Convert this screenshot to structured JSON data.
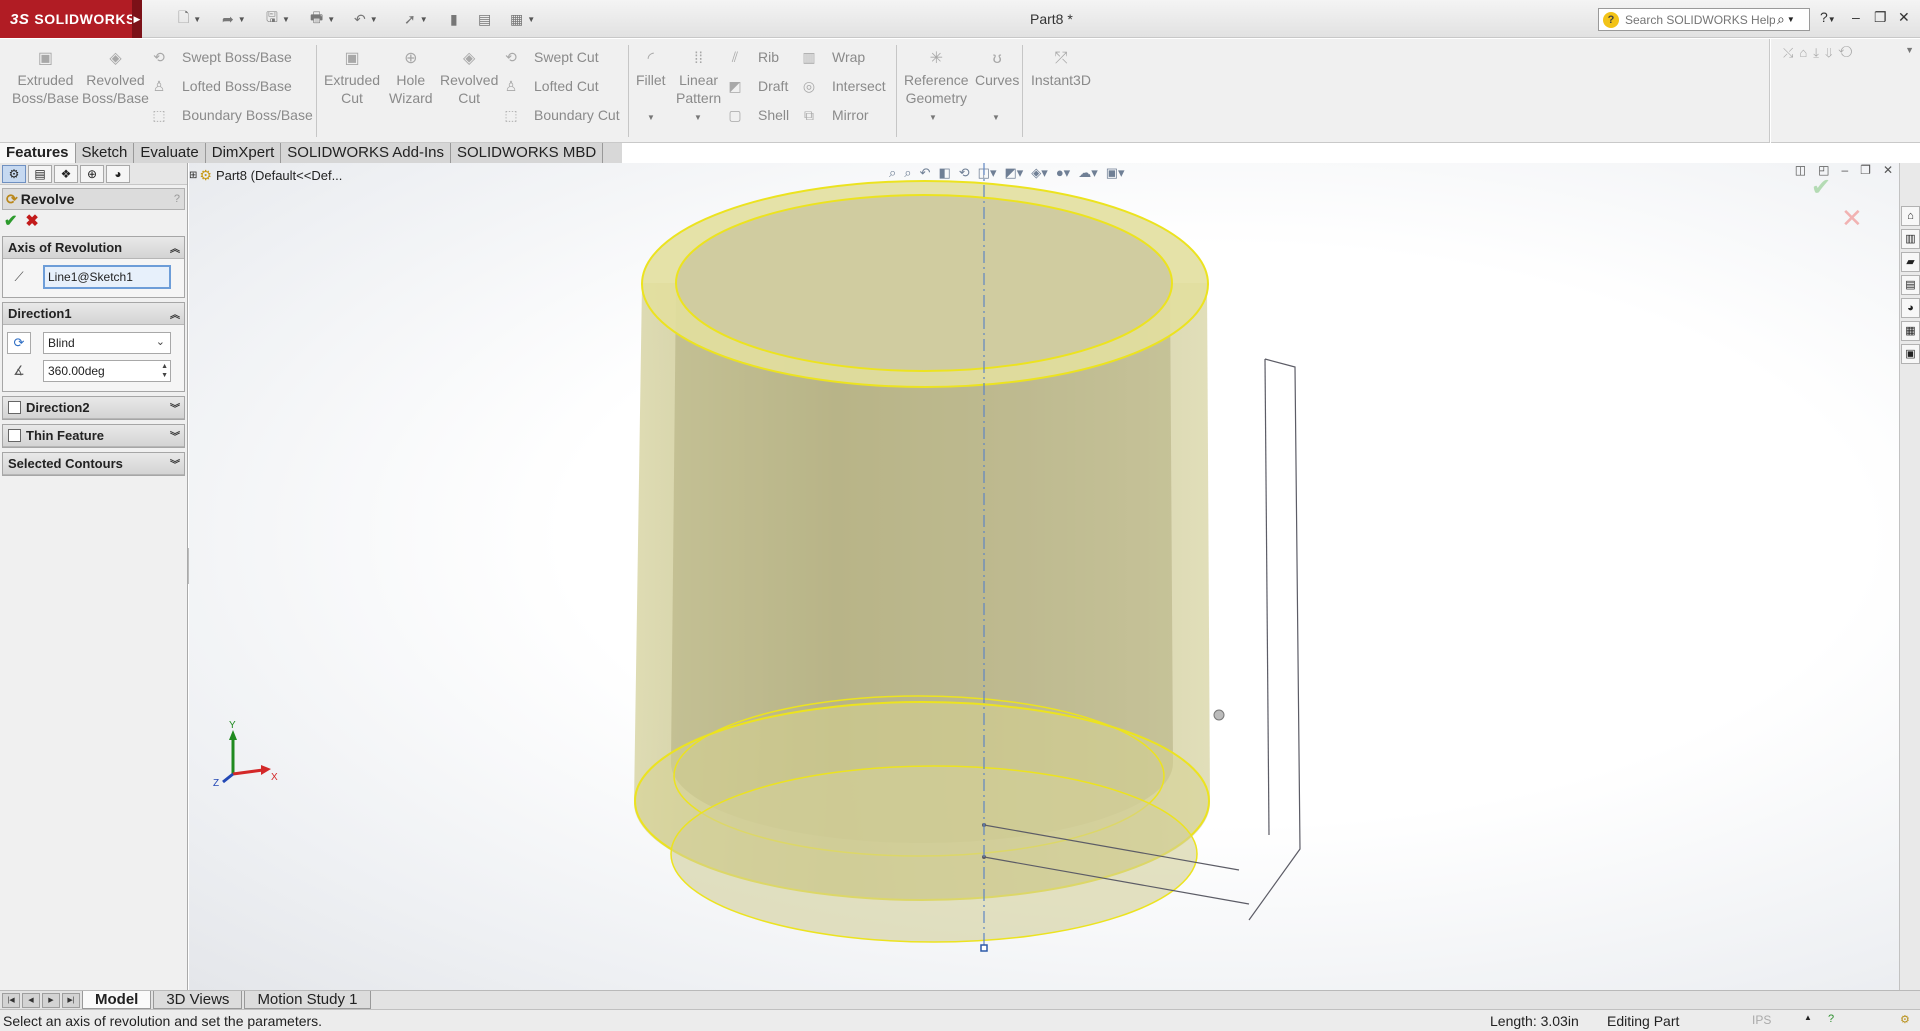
{
  "app": {
    "brand": "SOLIDWORKS",
    "brand_mark": "3S",
    "doc_title": "Part8 *",
    "search_placeholder": "Search SOLIDWORKS Help"
  },
  "ribbon": {
    "features_large": [
      {
        "label1": "Extruded",
        "label2": "Boss/Base"
      },
      {
        "label1": "Revolved",
        "label2": "Boss/Base"
      }
    ],
    "boss_small": [
      "Swept Boss/Base",
      "Lofted Boss/Base",
      "Boundary Boss/Base"
    ],
    "cut_large": [
      {
        "label1": "Extruded",
        "label2": "Cut"
      },
      {
        "label1": "Hole",
        "label2": "Wizard"
      },
      {
        "label1": "Revolved",
        "label2": "Cut"
      }
    ],
    "cut_small": [
      "Swept Cut",
      "Lofted Cut",
      "Boundary Cut"
    ],
    "fillet": "Fillet",
    "linear_pattern": {
      "label1": "Linear",
      "label2": "Pattern"
    },
    "mods_small_1": [
      "Rib",
      "Draft",
      "Shell"
    ],
    "mods_small_2": [
      "Wrap",
      "Intersect",
      "Mirror"
    ],
    "ref_geometry": {
      "label1": "Reference",
      "label2": "Geometry"
    },
    "curves": "Curves",
    "instant3d": "Instant3D"
  },
  "tabs": [
    "Features",
    "Sketch",
    "Evaluate",
    "DimXpert",
    "SOLIDWORKS Add-Ins",
    "SOLIDWORKS MBD"
  ],
  "panel": {
    "title": "Revolve",
    "help": "?",
    "axis_group": "Axis of Revolution",
    "axis_value": "Line1@Sketch1",
    "direction1_group": "Direction1",
    "end_condition": "Blind",
    "angle": "360.00deg",
    "direction2_group": "Direction2",
    "thin_group": "Thin Feature",
    "contours_group": "Selected Contours"
  },
  "tree": {
    "node": "Part8  (Default<<Def..."
  },
  "triad": {
    "x": "X",
    "y": "Y",
    "z": "Z"
  },
  "bottom_tabs": [
    "Model",
    "3D Views",
    "Motion Study 1"
  ],
  "status": {
    "message": "Select an axis of revolution and set the parameters.",
    "length": "Length: 3.03in",
    "mode": "Editing Part",
    "units": "IPS"
  },
  "colors": {
    "brand_red": "#b11c24",
    "part_fill": "#d8d49a",
    "part_edge": "#e9e226",
    "accept_green": "#2d9b2d",
    "cancel_red": "#c21b1b"
  }
}
